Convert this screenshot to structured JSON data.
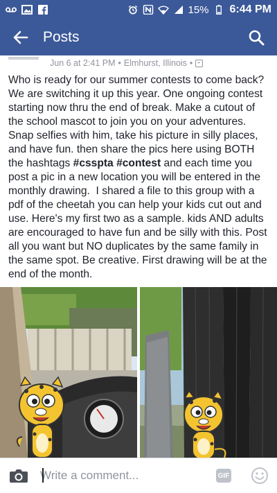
{
  "status_bar": {
    "battery": "15%",
    "time": "6:44 PM",
    "left_icons": [
      "voicemail-icon",
      "image-icon",
      "facebook-icon"
    ],
    "right_icons": [
      "alarm-icon",
      "nfc-icon",
      "wifi-icon",
      "signal-icon",
      "battery-icon"
    ]
  },
  "app_bar": {
    "title": "Posts",
    "back_icon": "arrow-left-icon",
    "search_icon": "search-icon"
  },
  "post": {
    "meta": {
      "date": "Jun 6 at 2:41 PM",
      "separator": "•",
      "location": "Elmhurst, Illinois",
      "separator2": "•",
      "privacy_icon": "group-privacy-icon"
    },
    "text_part1": "Who is ready for our summer contests to come back? We are switching it up this year. One ongoing contest starting now thru the end of break. Make a cutout of the school mascot to join you on your adventures. Snap selfies with him, take his picture in silly places, and have fun. then share the pics here using BOTH the hashtags ",
    "hashtag1": "#csspta",
    "text_space": " ",
    "hashtag2": "#contest",
    "text_part2": " and each time you post a pic in a new location you will be entered in the monthly drawing.  I shared a file to this group with a pdf of the cheetah you can help your kids cut out and use. Here's my first two as a sample. kids AND adults are encouraged to have fun and be silly with this. Post all you want but NO duplicates by the same family in the same spot. Be creative. First drawing will be at the end of the month.",
    "photos": [
      "car-dashboard-photo",
      "stone-pillars-photo"
    ]
  },
  "comment_bar": {
    "placeholder": "Write a comment...",
    "gif_label": "GIF",
    "camera_icon": "camera-icon",
    "emoji_icon": "smiley-icon"
  },
  "colors": {
    "brand": "#3b5998",
    "meta_gray": "#90949c",
    "text": "#1d2129"
  }
}
